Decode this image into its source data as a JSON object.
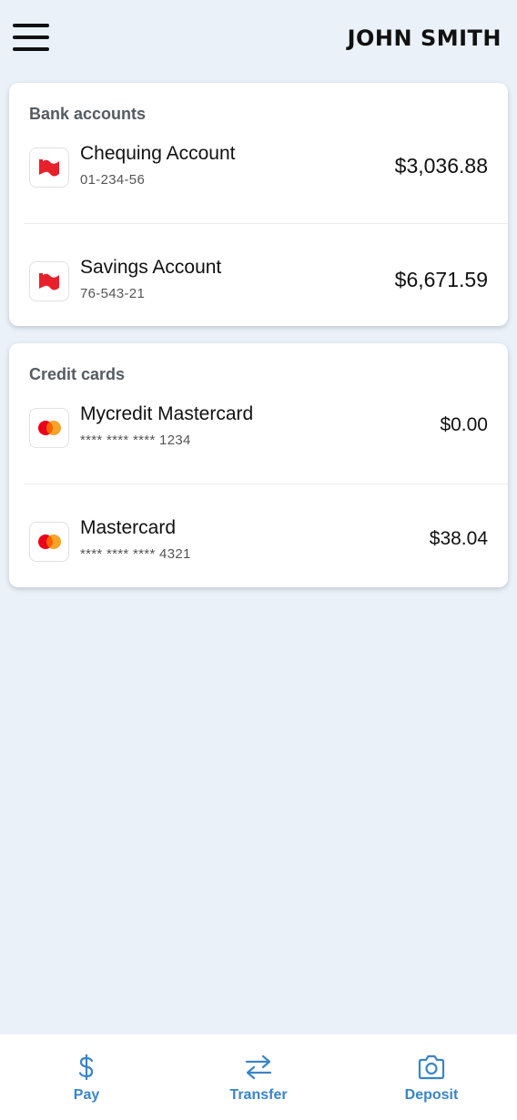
{
  "header": {
    "user_name": "JOHN SMITH",
    "menu_icon": "hamburger-menu-icon"
  },
  "bank_accounts": {
    "title": "Bank accounts",
    "items": [
      {
        "name": "Chequing Account",
        "number": "01-234-56",
        "balance": "$3,036.88",
        "icon": "bank-flag-icon"
      },
      {
        "name": "Savings Account",
        "number": "76-543-21",
        "balance": "$6,671.59",
        "icon": "bank-flag-icon"
      }
    ]
  },
  "credit_cards": {
    "title": "Credit cards",
    "items": [
      {
        "name": "Mycredit Mastercard",
        "number": "**** **** **** 1234",
        "balance": "$0.00",
        "icon": "mastercard-icon"
      },
      {
        "name": "Mastercard",
        "number": "**** **** **** 4321",
        "balance": "$38.04",
        "icon": "mastercard-icon"
      }
    ]
  },
  "bottom_nav": {
    "tabs": [
      {
        "label": "Pay",
        "icon": "dollar-icon"
      },
      {
        "label": "Transfer",
        "icon": "transfer-arrows-icon"
      },
      {
        "label": "Deposit",
        "icon": "camera-icon"
      }
    ]
  },
  "colors": {
    "background": "#eaf1f9",
    "accent": "#3a84c8",
    "flag_red": "#e8202a",
    "mastercard_red": "#eb001b",
    "mastercard_orange": "#f79e1b"
  }
}
